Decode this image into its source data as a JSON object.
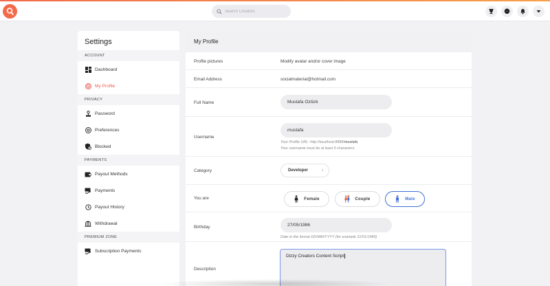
{
  "topbar": {
    "search_placeholder": "Search Creators",
    "accent_gradient": [
      "#f26b4a",
      "#f7a04b"
    ],
    "icons": [
      "logo-icon",
      "search-icon",
      "trophy-icon",
      "messenger-icon",
      "bell-icon",
      "caret-down-icon"
    ]
  },
  "sidebar": {
    "title": "Settings",
    "sections": [
      {
        "header": "ACCOUNT",
        "items": [
          {
            "label": "Dashboard",
            "icon": "dashboard-icon"
          },
          {
            "label": "My Profile",
            "icon": "profile-icon",
            "active": true
          }
        ]
      },
      {
        "header": "PRIVACY",
        "items": [
          {
            "label": "Password",
            "icon": "password-icon"
          },
          {
            "label": "Preferences",
            "icon": "preferences-icon"
          },
          {
            "label": "Blocked",
            "icon": "blocked-icon"
          }
        ]
      },
      {
        "header": "PAYMENTS",
        "items": [
          {
            "label": "Payout Methods",
            "icon": "wallet-icon"
          },
          {
            "label": "Payments",
            "icon": "payments-icon"
          },
          {
            "label": "Payout History",
            "icon": "history-icon"
          },
          {
            "label": "Withdrawal",
            "icon": "bank-icon"
          }
        ]
      },
      {
        "header": "PREMIUM ZONE",
        "items": [
          {
            "label": "Subscription Payments",
            "icon": "subscription-icon"
          }
        ]
      }
    ],
    "active_color": "#ec5c52"
  },
  "main": {
    "title": "My Profile",
    "profile_pictures": {
      "label": "Profile pictures",
      "value": "Modify avatar and/or cover image"
    },
    "email": {
      "label": "Email Address",
      "value": "socialmaterial@hotmail.com"
    },
    "full_name": {
      "label": "Full Name",
      "value": "Mustafa Öztürk"
    },
    "username": {
      "label": "Username",
      "value": "mustafa",
      "hint_url_prefix": "Your Profile URL: http://localhost:8888/",
      "hint_url_user": "mustafa",
      "hint_length": "Your username must be at least 5 characters."
    },
    "category": {
      "label": "Category",
      "value": "Developer"
    },
    "you_are": {
      "label": "You are",
      "options": [
        {
          "label": "Female",
          "icon": "female-icon"
        },
        {
          "label": "Couple",
          "icon": "couple-icon"
        },
        {
          "label": "Male",
          "icon": "male-icon",
          "selected": true
        }
      ],
      "selected_color": "#3f6fd8"
    },
    "birthday": {
      "label": "Birthday",
      "value": "27/05/1986",
      "hint": "Date in the format DD/MM/YYYY (for example 31/01/1989)"
    },
    "description": {
      "label": "Description",
      "value": "Dizzy Creators Content Script"
    }
  }
}
